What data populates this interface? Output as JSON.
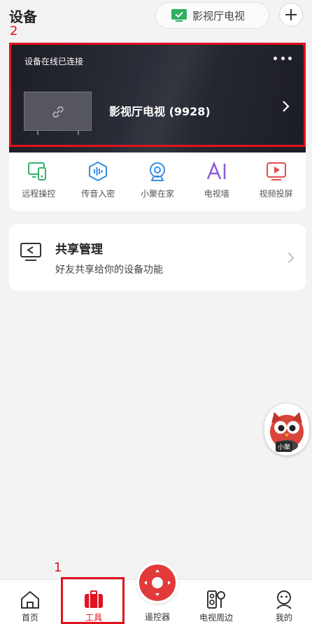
{
  "header": {
    "title": "设备",
    "tv_selector_label": "影视厅电视",
    "add_icon": "plus-icon"
  },
  "annotations": {
    "label_top": "2",
    "label_bottom": "1",
    "color": "#e0131f"
  },
  "device": {
    "status": "设备在线已连接",
    "name": "影视厅电视 (9928)",
    "more_icon": "more-dots-icon"
  },
  "tools": [
    {
      "label": "远程操控",
      "icon": "remote-control-icon",
      "color": "#35b26b"
    },
    {
      "label": "传音入密",
      "icon": "voice-wave-icon",
      "color": "#3a8de0"
    },
    {
      "label": "小聚在家",
      "icon": "camera-icon",
      "color": "#3a8de0"
    },
    {
      "label": "电视墙",
      "icon": "ai-icon",
      "color": "#8a5bd6"
    },
    {
      "label": "视频投屏",
      "icon": "screen-cast-icon",
      "color": "#e05050"
    }
  ],
  "share": {
    "title": "共享管理",
    "subtitle": "好友共享给你的设备功能"
  },
  "mascot": {
    "label": "小聚"
  },
  "tabbar": {
    "items": [
      {
        "label": "首页",
        "icon": "home-icon"
      },
      {
        "label": "工具",
        "icon": "toolbox-icon"
      },
      {
        "label": "遥控器",
        "icon": "remote-dpad-icon"
      },
      {
        "label": "电视周边",
        "icon": "speaker-mic-icon"
      },
      {
        "label": "我的",
        "icon": "profile-icon"
      }
    ],
    "active_index": 1,
    "accent": "#e0131f"
  }
}
